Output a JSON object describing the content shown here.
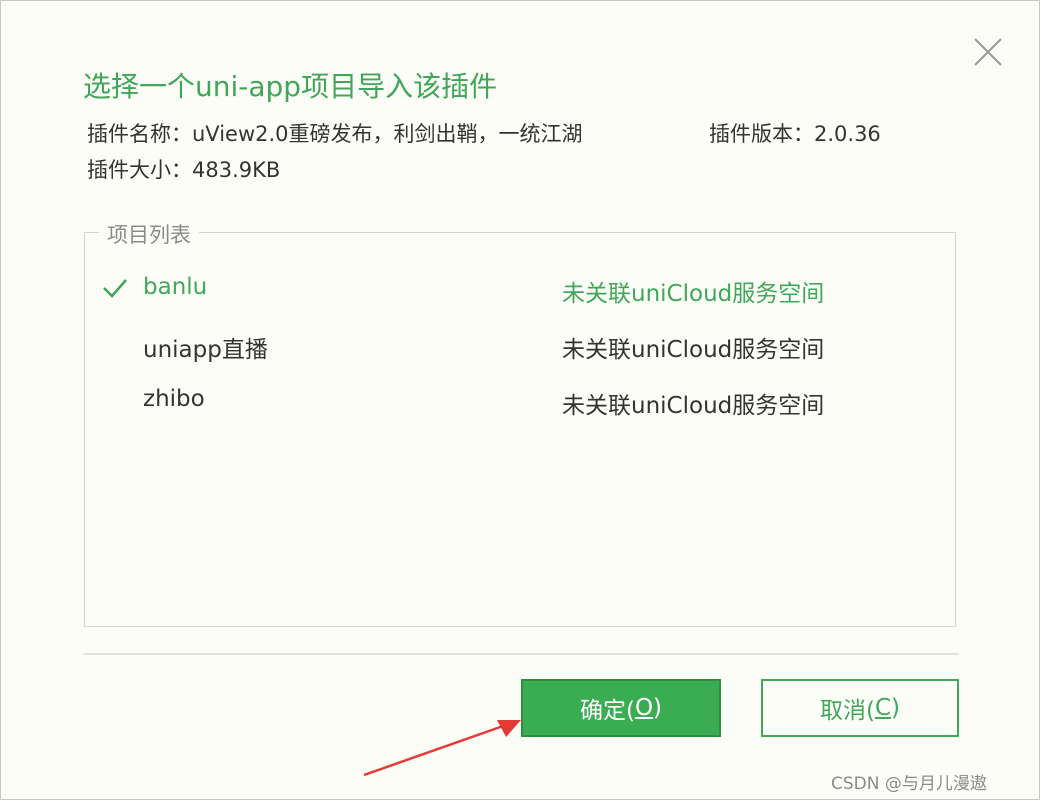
{
  "dialog": {
    "title": "选择一个uni-app项目导入该插件",
    "plugin_name": "插件名称：uView2.0重磅发布，利剑出鞘，一统江湖",
    "plugin_version": "插件版本：2.0.36",
    "plugin_size": "插件大小：483.9KB",
    "close_icon": "close-icon"
  },
  "project_list": {
    "legend": "项目列表",
    "items": [
      {
        "name": "banlu",
        "status": "未关联uniCloud服务空间",
        "selected": true
      },
      {
        "name": "uniapp直播",
        "status": "未关联uniCloud服务空间",
        "selected": false
      },
      {
        "name": "zhibo",
        "status": "未关联uniCloud服务空间",
        "selected": false
      }
    ]
  },
  "buttons": {
    "ok_label": "确定(",
    "ok_key": "O",
    "ok_end": ")",
    "cancel_label": "取消(",
    "cancel_key": "C",
    "cancel_end": ")"
  },
  "colors": {
    "accent": "#3fa65a",
    "ok_button": "#3aad52",
    "annotation_arrow": "#e53935"
  },
  "watermark": "CSDN @与月儿漫遨"
}
